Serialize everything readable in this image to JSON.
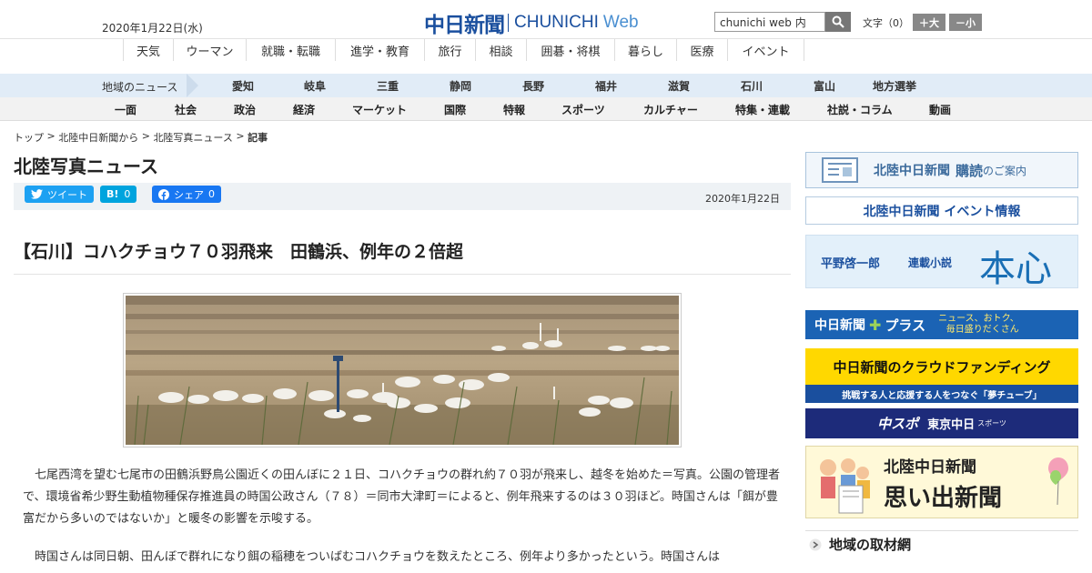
{
  "header": {
    "date": "2020年1月22日(水)",
    "logo_jp": "中日新聞",
    "logo_en": "CHUNICHI",
    "logo_web": "Web",
    "search_value": "chunichi web 内",
    "text_size_label": "文字（0）",
    "size_up_label": "＋大",
    "size_down_label": "－小"
  },
  "top_nav": [
    {
      "label": "天気"
    },
    {
      "label": "ウーマン"
    },
    {
      "label": "就職・転職"
    },
    {
      "label": "進学・教育"
    },
    {
      "label": "旅行"
    },
    {
      "label": "相談"
    },
    {
      "label": "囲碁・将棋"
    },
    {
      "label": "暮らし"
    },
    {
      "label": "医療"
    },
    {
      "label": "イベント"
    }
  ],
  "region_nav": {
    "label": "地域のニュース",
    "items": [
      "愛知",
      "岐阜",
      "三重",
      "静岡",
      "長野",
      "福井",
      "滋賀",
      "石川",
      "富山",
      "地方選挙"
    ]
  },
  "category_nav": [
    "一面",
    "社会",
    "政治",
    "経済",
    "マーケット",
    "国際",
    "特報",
    "スポーツ",
    "カルチャー",
    "特集・連載",
    "社説・コラム",
    "動画"
  ],
  "breadcrumb": [
    "トップ",
    "北陸中日新聞から",
    "北陸写真ニュース",
    "記事"
  ],
  "page_title": "北陸写真ニュース",
  "share": {
    "tweet": "ツイート",
    "hatena": "B!",
    "hatena_count": "0",
    "facebook": "シェア",
    "facebook_count": "0",
    "date": "2020年1月22日"
  },
  "article": {
    "headline": "【石川】コハクチョウ７０羽飛来　田鶴浜、例年の２倍超",
    "paragraphs": [
      "七尾西湾を望む七尾市の田鶴浜野鳥公園近くの田んぼに２１日、コハクチョウの群れ約７０羽が飛来し、越冬を始めた＝写真。公園の管理者で、環境省希少野生動植物種保存推進員の時国公政さん（７８）＝同市大津町＝によると、例年飛来するのは３０羽ほど。時国さんは「餌が豊富だから多いのではないか」と暖冬の影響を示唆する。",
      "時国さんは同日朝、田んぼで群れになり餌の稲穂をついばむコハクチョウを数えたところ、例年より多かったという。時国さんは"
    ]
  },
  "sidebar": {
    "kodoku_title": "北陸中日新聞",
    "kodoku_bold": "購読",
    "kodoku_rest": "のご案内",
    "event_label": "北陸中日新聞 イベント情報",
    "novel_author": "平野啓一郎",
    "novel_series": "連載小説",
    "novel_title": "本心",
    "plus_logo": "中日新聞",
    "plus_name": "プラス",
    "plus_tag1": "ニュース、おトク、",
    "plus_tag2": "毎日盛りだくさん",
    "cf_title": "中日新聞のクラウドファンディング",
    "cf_sub": "挑戦する人と応援する人をつなぐ「夢チューブ」",
    "chuspo_logo": "中スポ",
    "chuspo_sub": "東京中日",
    "chuspo_tag": "スポーツ",
    "omoide_line1": "北陸中日新聞",
    "omoide_line2": "思い出新聞",
    "section_title": "地域の取材網"
  },
  "colors": {
    "brand_blue": "#1a4f9e",
    "twitter": "#1da1f2",
    "hatena": "#00a4de",
    "facebook": "#1877f2",
    "region_bg": "#e1ecf7",
    "cf_yellow": "#ffd800"
  },
  "icons": [
    "search-icon",
    "twitter-bird-icon",
    "facebook-f-icon",
    "newspaper-icon",
    "chevron-right-icon",
    "balloon-icon"
  ]
}
